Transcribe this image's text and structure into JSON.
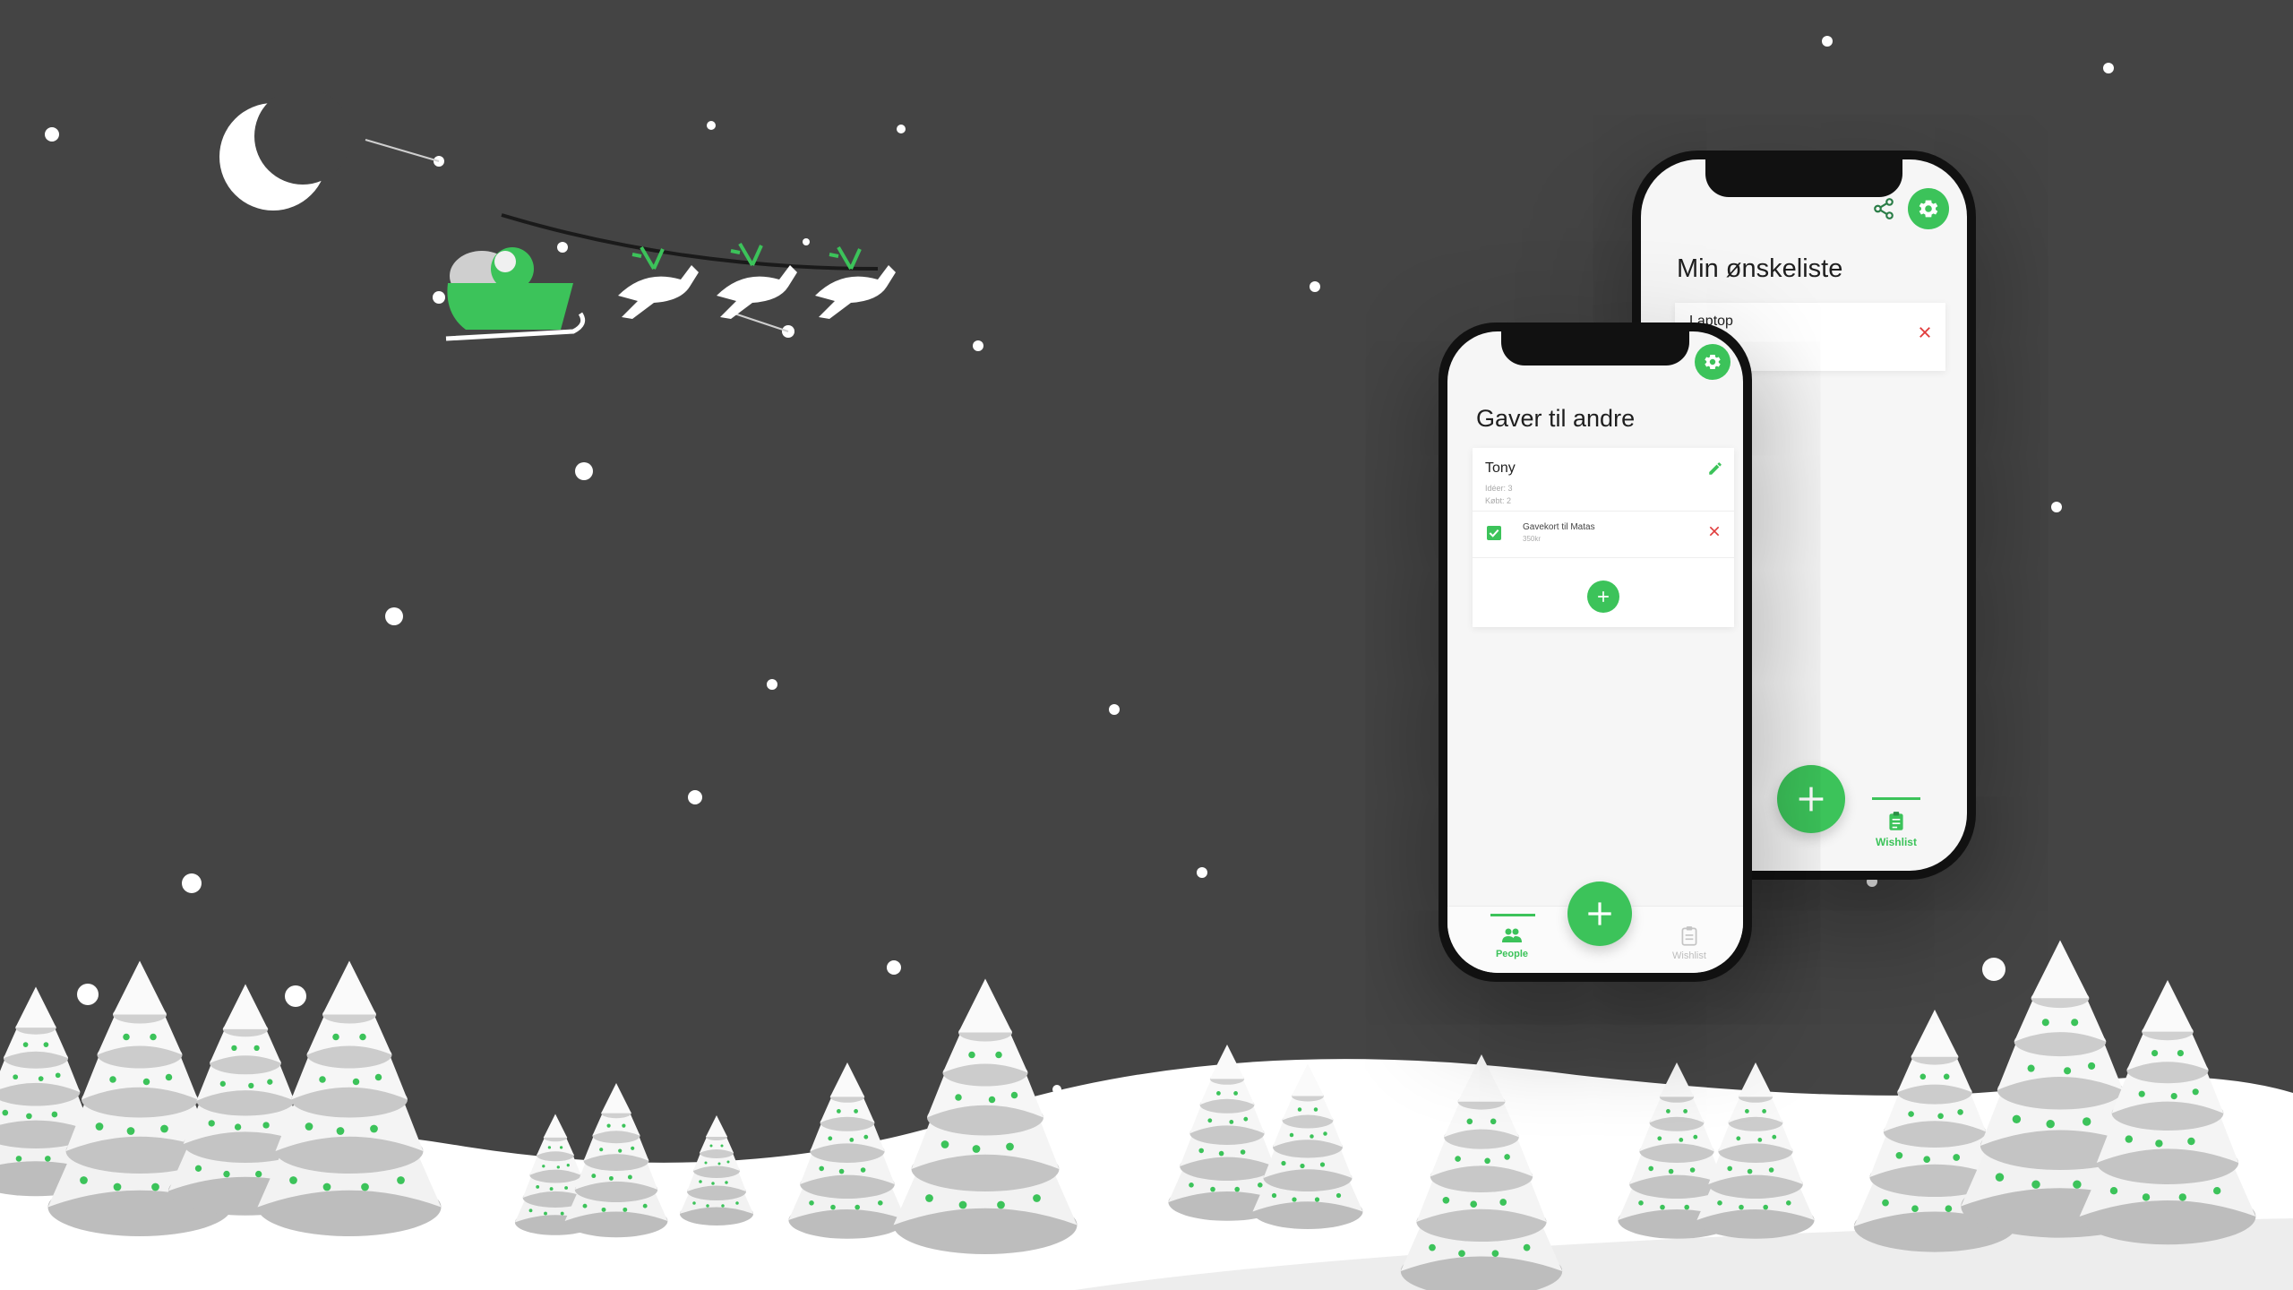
{
  "colors": {
    "background": "#444444",
    "accent": "#3cc35a",
    "danger": "#e03b3b",
    "snow": "#ffffff"
  },
  "phone_back": {
    "title": "Min ønskeliste",
    "items": [
      {
        "label": "Laptop"
      }
    ],
    "tab": {
      "label": "Wishlist"
    },
    "icons": [
      "share-icon",
      "gear-icon",
      "plus-icon",
      "clipboard-icon",
      "close-icon"
    ]
  },
  "phone_front": {
    "title": "Gaver til andre",
    "person": {
      "name": "Tony",
      "ideas": "Idéer: 3",
      "bought": "Købt: 2"
    },
    "gift": {
      "label": "Gavekort til Matas",
      "price": "350kr"
    },
    "tabs": [
      {
        "label": "People"
      },
      {
        "label": "Wishlist"
      }
    ],
    "icons": [
      "gear-icon",
      "edit-icon",
      "checkbox-icon",
      "close-icon",
      "plus-icon",
      "people-icon",
      "clipboard-icon"
    ]
  }
}
